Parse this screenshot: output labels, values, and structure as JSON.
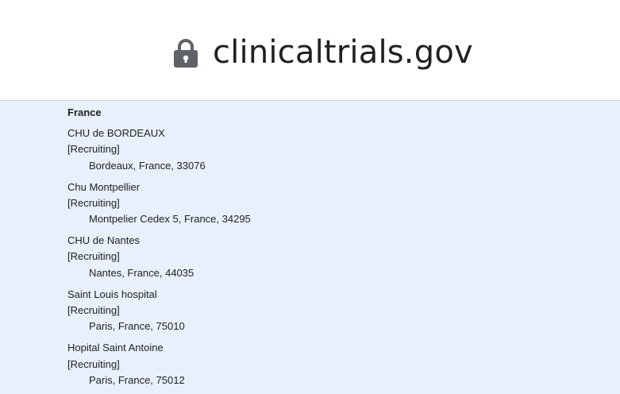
{
  "browser": {
    "url": "clinicaltrials.gov",
    "lock_icon": "lock-icon"
  },
  "locations": {
    "country": "France",
    "sites": [
      {
        "name": "CHU de BORDEAUX",
        "status": "[Recruiting]",
        "address": "Bordeaux, France, 33076"
      },
      {
        "name": "Chu Montpellier",
        "status": "[Recruiting]",
        "address": "Montpelier Cedex 5, France, 34295"
      },
      {
        "name": "CHU de Nantes",
        "status": "[Recruiting]",
        "address": "Nantes, France, 44035"
      },
      {
        "name": "Saint Louis hospital",
        "status": "[Recruiting]",
        "address": "Paris, France, 75010"
      },
      {
        "name": "Hopital Saint Antoine",
        "status": "[Recruiting]",
        "address": "Paris, France, 75012"
      }
    ]
  }
}
